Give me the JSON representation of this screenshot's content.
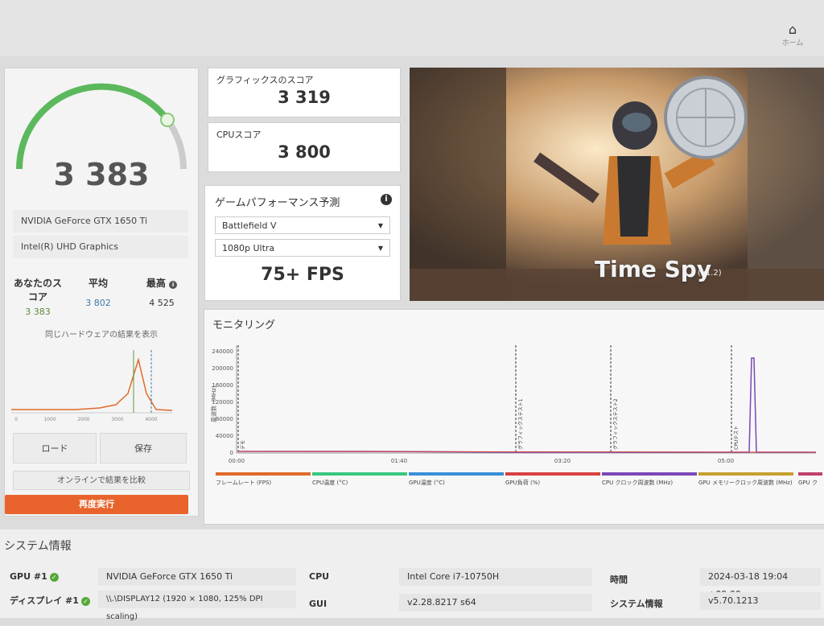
{
  "header": {
    "home_label": "ホーム"
  },
  "left": {
    "score": "3 383",
    "hw1": "NVIDIA GeForce GTX 1650 Ti",
    "hw2": "Intel(R) UHD Graphics",
    "stats": [
      {
        "label": "あなたのスコア",
        "value": "3 383",
        "color": "#5a8a3a"
      },
      {
        "label": "平均",
        "value": "3 802",
        "color": "#3a7aa8"
      },
      {
        "label": "最高",
        "value": "4 525",
        "color": "#333333"
      }
    ],
    "hist_title": "同じハードウェアの結果を表示",
    "hist_ticks": [
      "0",
      "1000",
      "2000",
      "3000",
      "4000"
    ],
    "load_label": "ロード",
    "save_label": "保存",
    "compare_label": "オンラインで結果を比較",
    "run_label": "再度実行"
  },
  "graphics": {
    "label": "グラフィックスのスコア",
    "value": "3 319"
  },
  "cpu": {
    "label": "CPUスコア",
    "value": "3 800"
  },
  "perf": {
    "title": "ゲームパフォーマンス予測",
    "game": "Battlefield V",
    "preset": "1080p Ultra",
    "fps": "75+ FPS"
  },
  "hero": {
    "title": "Time Spy",
    "version": "(v1.2)"
  },
  "monitor": {
    "title": "モニタリング",
    "ylabel": "周波数（MHz）",
    "yticks": [
      "0",
      "40000",
      "80000",
      "120000",
      "160000",
      "200000",
      "240000"
    ],
    "xticks": [
      "00:00",
      "01:40",
      "03:20",
      "05:00"
    ],
    "markers": [
      "デモ",
      "グラフィックステスト1",
      "グラフィックステスト2",
      "CPUテスト"
    ],
    "legend": [
      {
        "label": "フレームレート (FPS)",
        "color": "#e06a2a"
      },
      {
        "label": "CPU温度 (°C)",
        "color": "#38c77f"
      },
      {
        "label": "GPU温度 (°C)",
        "color": "#3a8fd8"
      },
      {
        "label": "GPU負荷 (%)",
        "color": "#d84040"
      },
      {
        "label": "CPU クロック周波数 (MHz)",
        "color": "#7a48b8"
      },
      {
        "label": "GPU メモリークロック周波数 (MHz)",
        "color": "#c8a030"
      },
      {
        "label": "GPU ク",
        "color": "#c0406a"
      }
    ]
  },
  "sysinfo": {
    "title": "システム情報",
    "gpu_label": "GPU #1",
    "gpu_value": "NVIDIA GeForce GTX 1650 Ti",
    "display_label": "ディスプレイ #1",
    "display_value": "\\\\.\\DISPLAY12 (1920 × 1080, 125% DPI scaling)",
    "cpu_label": "CPU",
    "cpu_value": "Intel Core i7-10750H",
    "gui_label": "GUI",
    "gui_value": "v2.28.8217 s64",
    "time_label": "時間",
    "time_value": "2024-03-18 19:04 +09:00",
    "sysinfo_label": "システム情報",
    "sysinfo_value": "v5.70.1213"
  }
}
